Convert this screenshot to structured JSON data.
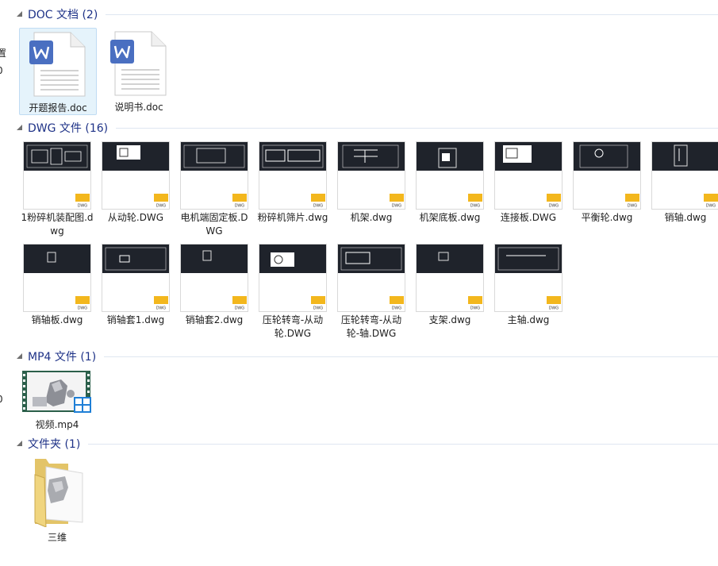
{
  "groups": [
    {
      "title": "DOC 文档 (2)"
    },
    {
      "title": "DWG 文件 (16)"
    },
    {
      "title": "MP4 文件 (1)"
    },
    {
      "title": "文件夹 (1)"
    }
  ],
  "left_edge": {
    "frag1": "置",
    "frag2": "0",
    "frag3": "0"
  },
  "doc_files": [
    {
      "name": "开题报告.doc",
      "icon": "wps-writer-icon"
    },
    {
      "name": "说明书.doc",
      "icon": "wps-writer-icon"
    }
  ],
  "dwg_files": [
    {
      "name": "1粉碎机装配图.dwg"
    },
    {
      "name": "从动轮.DWG"
    },
    {
      "name": "电机端固定板.DWG"
    },
    {
      "name": "粉碎机筛片.dwg"
    },
    {
      "name": "机架.dwg"
    },
    {
      "name": "机架底板.dwg"
    },
    {
      "name": "连接板.DWG"
    },
    {
      "name": "平衡轮.dwg"
    },
    {
      "name": "销轴.dwg"
    },
    {
      "name": "销轴板.dwg"
    },
    {
      "name": "销轴套1.dwg"
    },
    {
      "name": "销轴套2.dwg"
    },
    {
      "name": "压轮转弯-从动轮.DWG"
    },
    {
      "name": "压轮转弯-从动轮-轴.DWG"
    },
    {
      "name": "支架.dwg"
    },
    {
      "name": "主轴.dwg"
    }
  ],
  "mp4_files": [
    {
      "name": "视频.mp4",
      "icon": "video-thumbnail-icon"
    }
  ],
  "folders": [
    {
      "name": "三维",
      "icon": "folder-icon"
    }
  ],
  "colors": {
    "group_title": "#1e3287",
    "divider": "#dfe6f1",
    "selection": "#e5f3fb",
    "dwg_dark": "#1f232b",
    "wps_blue": "#4a6fc1"
  }
}
